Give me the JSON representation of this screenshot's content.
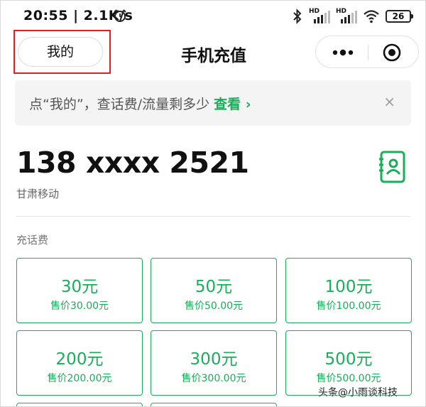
{
  "status_bar": {
    "time": "20:55 | 2.1K/s",
    "battery": "26"
  },
  "nav": {
    "me_button": "我的",
    "title": "手机充值"
  },
  "notice": {
    "text": "点“我的”，查话费/流量剩多少",
    "link": "查看",
    "close": "×"
  },
  "account": {
    "phone": "138 xxxx 2521",
    "carrier": "甘肃移动"
  },
  "section": {
    "label": "充话费"
  },
  "options": [
    {
      "amount": "30元",
      "price": "售价30.00元"
    },
    {
      "amount": "50元",
      "price": "售价50.00元"
    },
    {
      "amount": "100元",
      "price": "售价100.00元"
    },
    {
      "amount": "200元",
      "price": "售价200.00元"
    },
    {
      "amount": "300元",
      "price": "售价300.00元"
    },
    {
      "amount": "500元",
      "price": "售价500.00元"
    }
  ],
  "watermark": "头条@小雨谈科技",
  "colors": {
    "accent": "#1aad5a",
    "highlight": "#e02020"
  }
}
